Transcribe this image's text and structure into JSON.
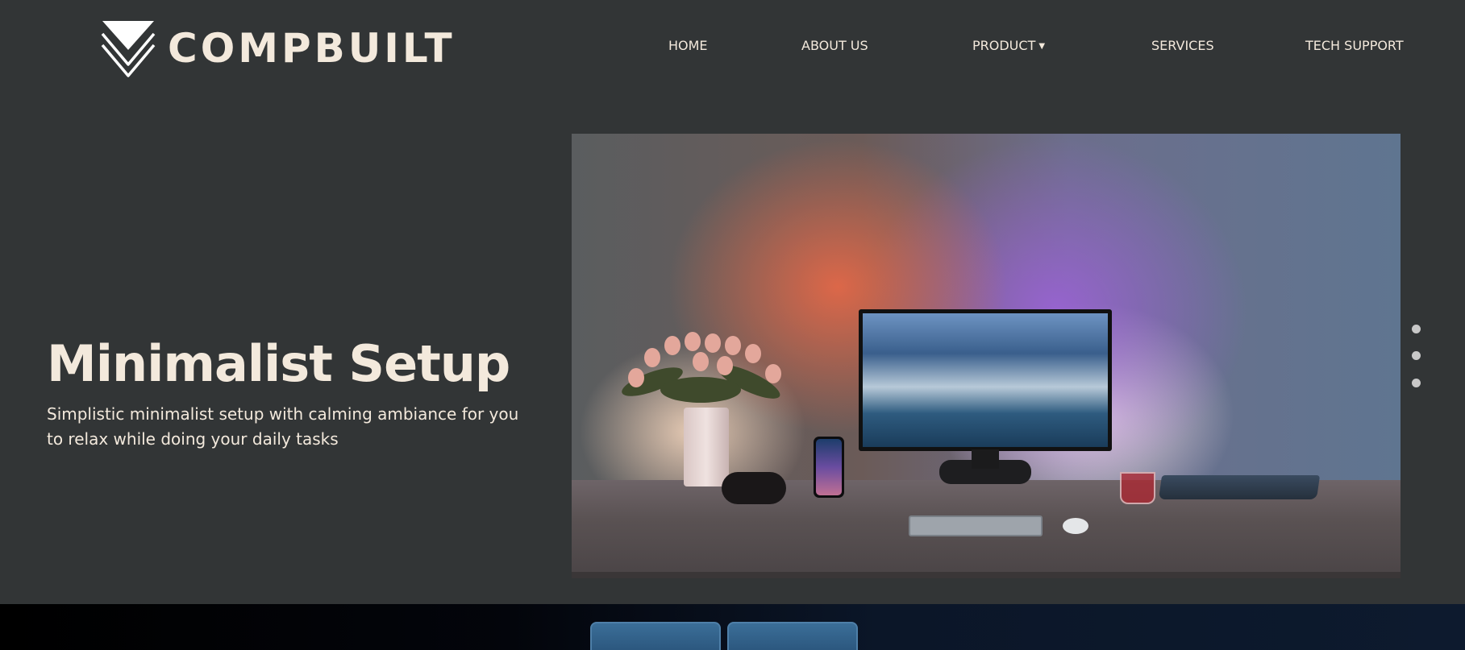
{
  "brand": {
    "name": "COMPBUILT",
    "logo_icon": "stacked-triangles-icon"
  },
  "nav": {
    "items": [
      {
        "label": "HOME"
      },
      {
        "label": "ABOUT US"
      },
      {
        "label": "PRODUCT",
        "icon": "caret-down-icon"
      },
      {
        "label": "SERVICES"
      },
      {
        "label": "TECH SUPPORT"
      }
    ]
  },
  "hero": {
    "title": "Minimalist Setup",
    "description": "Simplistic minimalist setup with calming ambiance for you to relax while doing your daily tasks"
  },
  "slider": {
    "total_slides": 3
  },
  "colors": {
    "background": "#323536",
    "text": "#f3e9dc",
    "dot": "#c8c8c8"
  }
}
